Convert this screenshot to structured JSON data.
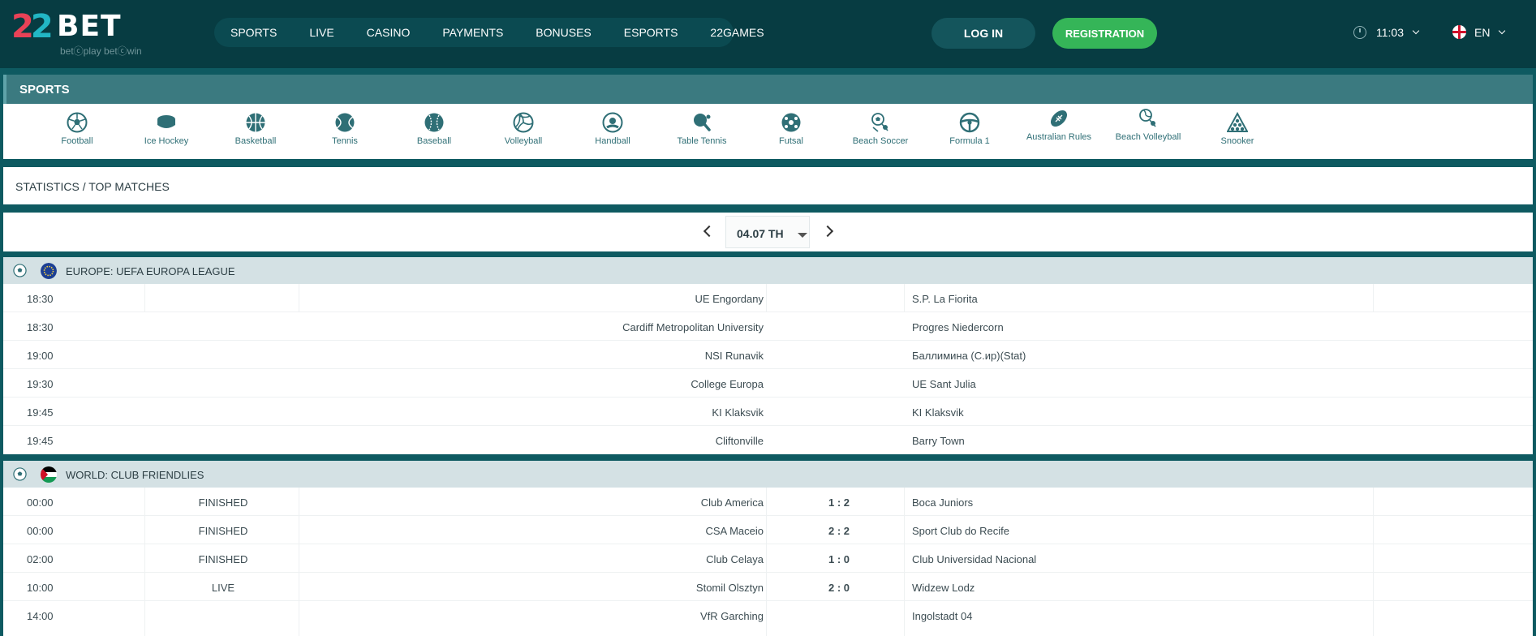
{
  "brand": {
    "num_left": "2",
    "num_right": "2",
    "word": "BET",
    "tagline": "betⓒplay  betⓒwin",
    "colors": {
      "red": "#e94257",
      "teal": "#22b6c4"
    }
  },
  "nav": [
    "SPORTS",
    "LIVE",
    "CASINO",
    "PAYMENTS",
    "BONUSES",
    "ESPORTS",
    "22GAMES"
  ],
  "auth": {
    "login": "LOG IN",
    "register": "REGISTRATION"
  },
  "clock": {
    "time": "11:03",
    "icon": "clock-icon"
  },
  "lang": {
    "code": "EN",
    "icon": "england-flag-icon"
  },
  "sports_title": "SPORTS",
  "sports": [
    {
      "label": "Football",
      "icon": "football-icon"
    },
    {
      "label": "Ice Hockey",
      "icon": "puck-icon"
    },
    {
      "label": "Basketball",
      "icon": "basketball-icon"
    },
    {
      "label": "Tennis",
      "icon": "tennis-icon"
    },
    {
      "label": "Baseball",
      "icon": "baseball-icon"
    },
    {
      "label": "Volleyball",
      "icon": "volleyball-icon"
    },
    {
      "label": "Handball",
      "icon": "handball-icon"
    },
    {
      "label": "Table Tennis",
      "icon": "table-tennis-icon"
    },
    {
      "label": "Futsal",
      "icon": "futsal-icon"
    },
    {
      "label": "Beach Soccer",
      "icon": "beach-soccer-icon"
    },
    {
      "label": "Formula 1",
      "icon": "steering-wheel-icon"
    },
    {
      "label": "Australian Rules",
      "icon": "australian-rules-icon"
    },
    {
      "label": "Beach Volleyball",
      "icon": "beach-volleyball-icon"
    },
    {
      "label": "Snooker",
      "icon": "snooker-icon"
    }
  ],
  "breadcrumb": "STATISTICS / TOP MATCHES",
  "date": {
    "value": "04.07 TH"
  },
  "leagues": [
    {
      "name": "EUROPE: UEFA EUROPA LEAGUE",
      "matches": [
        {
          "time": "18:30",
          "status": "",
          "home": "UE Engordany",
          "score": "",
          "away": "S.P. La Fiorita"
        },
        {
          "time": "18:30",
          "status": "",
          "home": "Cardiff Metropolitan University",
          "score": "",
          "away": "Progres Niedercorn"
        },
        {
          "time": "19:00",
          "status": "",
          "home": "NSI Runavik",
          "score": "",
          "away": "Баллимина (С.ир)(Stat)"
        },
        {
          "time": "19:30",
          "status": "",
          "home": "College Europa",
          "score": "",
          "away": "UE Sant Julia"
        },
        {
          "time": "19:45",
          "status": "",
          "home": "KI Klaksvik",
          "score": "",
          "away": "KI Klaksvik"
        },
        {
          "time": "19:45",
          "status": "",
          "home": "Cliftonville",
          "score": "",
          "away": "Barry Town"
        }
      ]
    },
    {
      "name": "WORLD: CLUB FRIENDLIES",
      "matches": [
        {
          "time": "00:00",
          "status": "FINISHED",
          "home": "Club America",
          "score": "1 : 2",
          "away": "Boca Juniors"
        },
        {
          "time": "00:00",
          "status": "FINISHED",
          "home": "CSA Maceio",
          "score": "2 : 2",
          "away": "Sport Club do Recife"
        },
        {
          "time": "02:00",
          "status": "FINISHED",
          "home": "Club Celaya",
          "score": "1 : 0",
          "away": "Club Universidad Nacional"
        },
        {
          "time": "10:00",
          "status": "LIVE",
          "home": "Stomil Olsztyn",
          "score": "2 : 0",
          "away": "Widzew Lodz"
        },
        {
          "time": "14:00",
          "status": "",
          "home": "VfR Garching",
          "score": "",
          "away": "Ingolstadt 04"
        }
      ]
    }
  ]
}
